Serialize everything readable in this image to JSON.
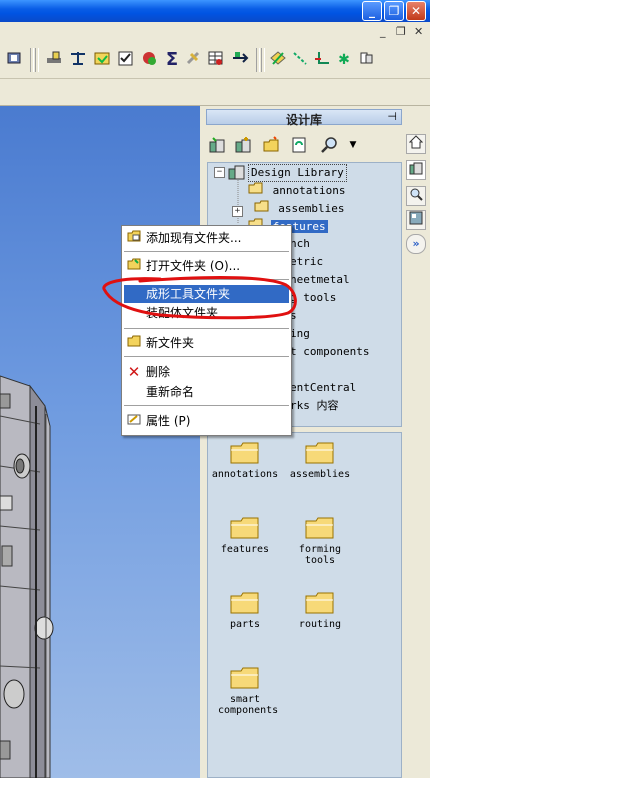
{
  "window": {
    "minimize_glyph": "_",
    "maximize_glyph": "❐",
    "close_glyph": "✕",
    "mdi_minimize": "_",
    "mdi_restore": "❐",
    "mdi_close": "✕"
  },
  "toolbar": {
    "icons": [
      "gear-icon",
      "pin-icon",
      "balance-icon",
      "fold-icon",
      "check-icon",
      "sketch-icon",
      "sigma-icon",
      "tool-icon",
      "table-icon",
      "arrows-icon",
      "line-icon",
      "sketchline-icon",
      "axis-icon",
      "point-icon",
      "plane-icon"
    ]
  },
  "design_library": {
    "title": "设计库",
    "pin_glyph": "⊣",
    "tree": {
      "root_label": "Design Library",
      "items": [
        {
          "label": "annotations"
        },
        {
          "label": "assemblies"
        },
        {
          "label": "features"
        },
        {
          "label": "nch"
        },
        {
          "label": "etric"
        },
        {
          "label": "heetmetal"
        },
        {
          "label": "g tools"
        },
        {
          "label": "s"
        },
        {
          "label": "ing"
        },
        {
          "label": "t components"
        },
        {
          "label": "entCentral"
        },
        {
          "label": "rks 内容"
        }
      ]
    },
    "folders": [
      {
        "label": "annotations"
      },
      {
        "label": "assemblies"
      },
      {
        "label": "features"
      },
      {
        "label": "forming tools"
      },
      {
        "label": "parts"
      },
      {
        "label": "routing"
      },
      {
        "label": "smart components"
      }
    ]
  },
  "context_menu": {
    "items": [
      {
        "label": "添加现有文件夹..."
      },
      {
        "label": "打开文件夹 (O)..."
      },
      {
        "label": "成形工具文件夹"
      },
      {
        "label": "装配体文件夹"
      },
      {
        "label": "新文件夹"
      },
      {
        "label": "删除"
      },
      {
        "label": "重新命名"
      },
      {
        "label": "属性 (P)"
      }
    ]
  },
  "colors": {
    "highlight": "#316ac5",
    "annotation_stroke": "#e01010",
    "viewport_top": "#4a7bd0",
    "viewport_bottom": "#9fbde8"
  }
}
